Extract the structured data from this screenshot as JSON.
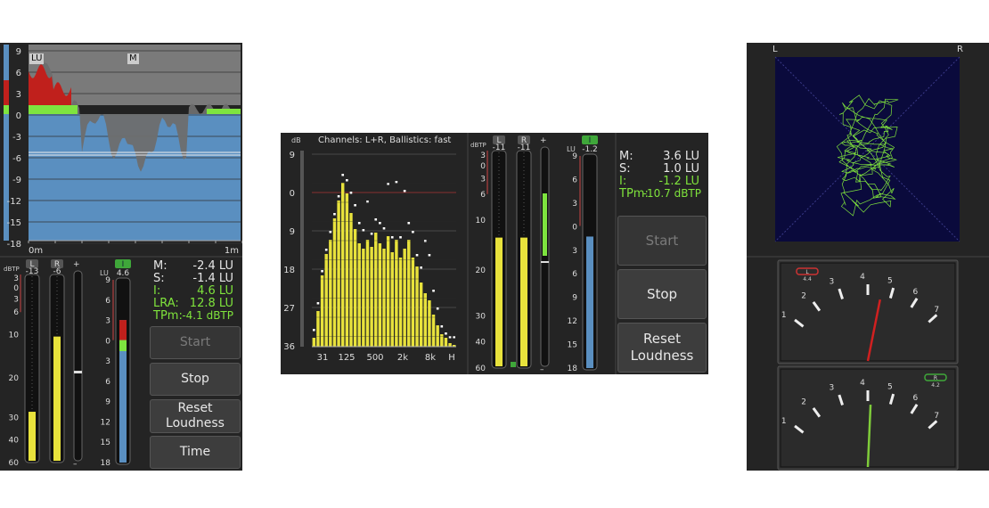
{
  "colors": {
    "background": "#242424",
    "yellow_bar": "#e8e23c",
    "red_zone": "#c0201c",
    "green_zone": "#7ee43f",
    "blue_meter": "#5a8fc0",
    "readout_green": "#7fe33c",
    "graph_gray": "#808080",
    "scope_bg": "#0a0a3c",
    "scope_trace": "#7fe33c",
    "needle_red": "#d02020",
    "needle_green": "#7fcc3a"
  },
  "panel1": {
    "graph": {
      "y_ticks": [
        "9",
        "6",
        "3",
        "0",
        "-3",
        "-6",
        "-9",
        "-12",
        "-15",
        "-18"
      ],
      "tag_lu": "LU",
      "tag_m": "M",
      "x_start": "0m",
      "x_end": "1m"
    },
    "meters": {
      "label_l": "L",
      "label_r": "R",
      "dbtp_unit": "dBTP",
      "value_l": "-13",
      "value_r": "-6",
      "dbtp_scale": [
        "3",
        "0",
        "3",
        "6",
        "10",
        "20",
        "30",
        "40",
        "60"
      ],
      "plus": "+",
      "minus": "–",
      "i_chip": "I",
      "lu_unit": "LU",
      "lu_value": "4.6",
      "lu_scale": [
        "9",
        "6",
        "3",
        "0",
        "3",
        "6",
        "9",
        "12",
        "15",
        "18"
      ],
      "level_l": 0.27,
      "level_r": 0.67,
      "lu_level": 0.78
    },
    "readouts": {
      "m_label": "M:",
      "m_value": "-2.4 LU",
      "s_label": "S:",
      "s_value": "-1.4 LU",
      "i_label": "I:",
      "i_value": "4.6 LU",
      "lra_label": "LRA:",
      "lra_value": "12.8 LU",
      "tpm_label": "TPm:",
      "tpm_value": "-4.1 dBTP"
    },
    "buttons": {
      "start": "Start",
      "stop": "Stop",
      "reset_1": "Reset",
      "reset_2": "Loudness",
      "time": "Time"
    }
  },
  "panel2": {
    "spectrum": {
      "db_label": "dB",
      "title": "Channels: L+R, Ballistics: fast",
      "y_ticks": [
        "9",
        "0",
        "9",
        "18",
        "27",
        "36"
      ],
      "x_ticks": [
        "31",
        "125",
        "500",
        "2k",
        "8k",
        "H"
      ],
      "bars": [
        0.05,
        0.2,
        0.4,
        0.52,
        0.6,
        0.72,
        0.82,
        0.92,
        0.86,
        0.75,
        0.66,
        0.58,
        0.55,
        0.6,
        0.56,
        0.64,
        0.58,
        0.55,
        0.62,
        0.53,
        0.6,
        0.5,
        0.55,
        0.6,
        0.5,
        0.45,
        0.36,
        0.3,
        0.26,
        0.18,
        0.12,
        0.07,
        0.05,
        0.02,
        0.01
      ],
      "peaks": [
        0.1,
        0.25,
        0.43,
        0.55,
        0.65,
        0.75,
        0.85,
        0.97,
        0.94,
        0.87,
        0.8,
        0.7,
        0.66,
        0.82,
        0.64,
        0.72,
        0.7,
        0.67,
        0.92,
        0.62,
        0.93,
        0.62,
        0.88,
        0.7,
        0.65,
        0.52,
        0.45,
        0.6,
        0.52,
        0.32,
        0.22,
        0.12,
        0.08,
        0.06,
        0.06
      ]
    },
    "meters": {
      "label_l": "L",
      "label_r": "R",
      "dbtp_unit": "dBTP",
      "value_l": "-11",
      "value_r": "-11",
      "dbtp_scale": [
        "3",
        "0",
        "3",
        "6",
        "10",
        "20",
        "30",
        "40",
        "60"
      ],
      "plus": "+",
      "minus": "–",
      "i_chip": "I",
      "lu_unit": "LU",
      "lu_value": "-1.2",
      "lu_scale": [
        "9",
        "6",
        "3",
        "0",
        "3",
        "6",
        "9",
        "12",
        "15",
        "18"
      ],
      "level_l": 0.6,
      "level_r": 0.6,
      "lu_level": 0.62
    },
    "readouts": {
      "m_label": "M:",
      "m_value": "3.6 LU",
      "s_label": "S:",
      "s_value": "1.0 LU",
      "i_label": "I:",
      "i_value": "-1.2 LU",
      "tpm_label": "TPm:",
      "tpm_value": "-10.7 dBTP"
    },
    "buttons": {
      "start": "Start",
      "stop": "Stop",
      "reset_1": "Reset",
      "reset_2": "Loudness"
    }
  },
  "panel3": {
    "scope": {
      "label_l": "L",
      "label_r": "R"
    },
    "meter_top": {
      "chip": "L",
      "value": "4.4",
      "scale": [
        "1",
        "2",
        "3",
        "4",
        "5",
        "6",
        "7"
      ]
    },
    "meter_bottom": {
      "chip": "R",
      "value": "4.2",
      "scale": [
        "1",
        "2",
        "3",
        "4",
        "5",
        "6",
        "7"
      ]
    }
  }
}
